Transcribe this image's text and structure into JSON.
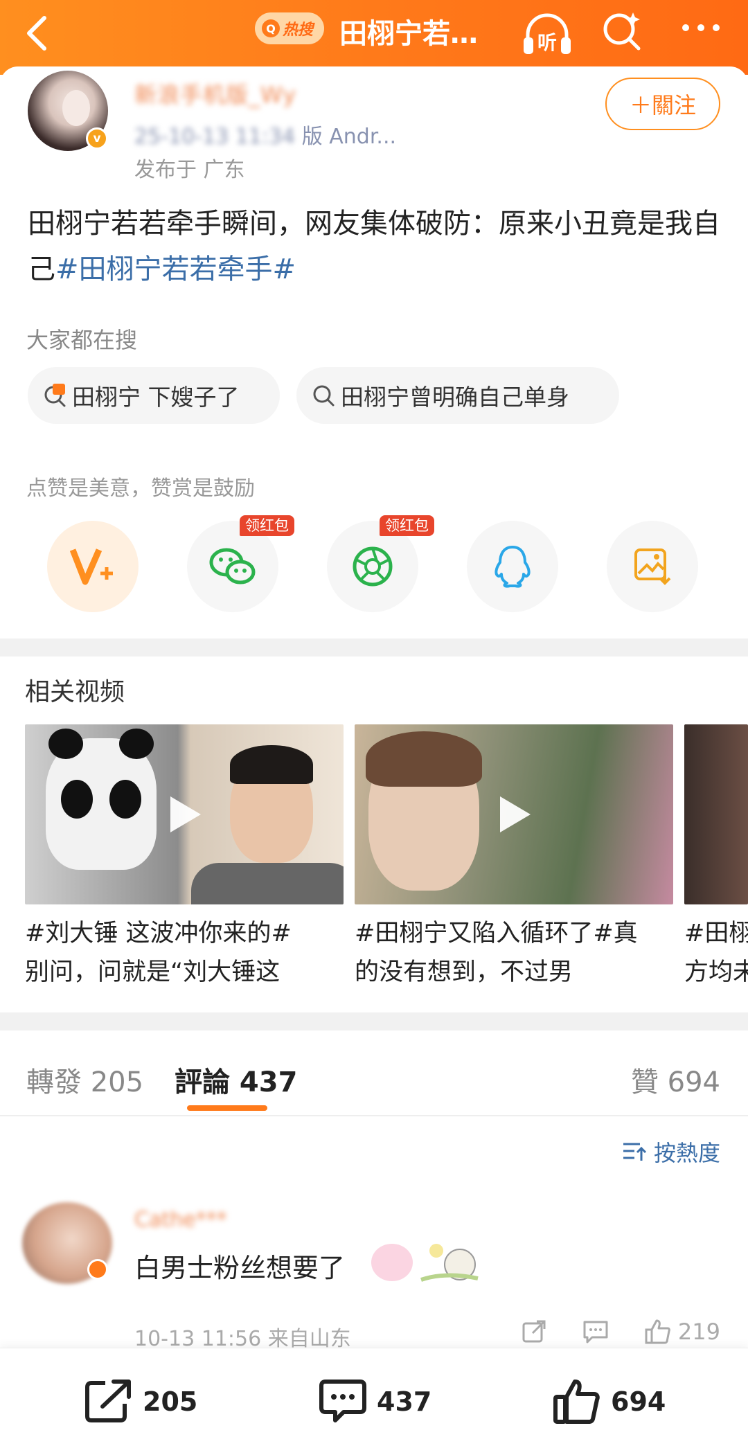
{
  "topbar": {
    "hot_search_label": "热搜",
    "title": "田栩宁若…",
    "listen_label": "听"
  },
  "author": {
    "name": "新浪手机版_Wy",
    "meta_device": "版 Andr...",
    "meta_date": "25-10-13 11:34",
    "location": "发布于 广东",
    "badge": "v",
    "follow_label": "＋關注"
  },
  "post": {
    "text": "田栩宁若若牵手瞬间，网友集体破防：原来小丑竟是我自己",
    "hashtag": "#田栩宁若若牵手#"
  },
  "search": {
    "heading": "大家都在搜",
    "chips": [
      "田栩宁 下嫂子了",
      "田栩宁曾明确自己单身"
    ],
    "hot_icon": "热"
  },
  "reward": {
    "hint": "点赞是美意，赞赏是鼓励",
    "red_packet_label": "领红包"
  },
  "related": {
    "heading": "相关视频",
    "videos": [
      {
        "line1": "#刘大锤 这波冲你来的#",
        "line2": "别问，问就是“刘大锤这"
      },
      {
        "line1": "#田栩宁又陷入循环了#真",
        "line2": "的没有想到，不过男"
      },
      {
        "line1": "#田栩",
        "line2": "方均未"
      }
    ]
  },
  "tabs": {
    "repost": "轉發 205",
    "comment": "評論 437",
    "like": "贊 694",
    "sort": "按熱度"
  },
  "comment": {
    "name": "Cathe***",
    "text": "白男士粉丝想要了",
    "meta": "10-13 11:56  来自山东",
    "likes": "219"
  },
  "bottom_bar": {
    "repost_count": "205",
    "comment_count": "437",
    "like_count": "694"
  },
  "colors": {
    "brand_orange": "#ff7a1a",
    "link_blue": "#3b6ea8",
    "red_packet": "#e8452c"
  }
}
